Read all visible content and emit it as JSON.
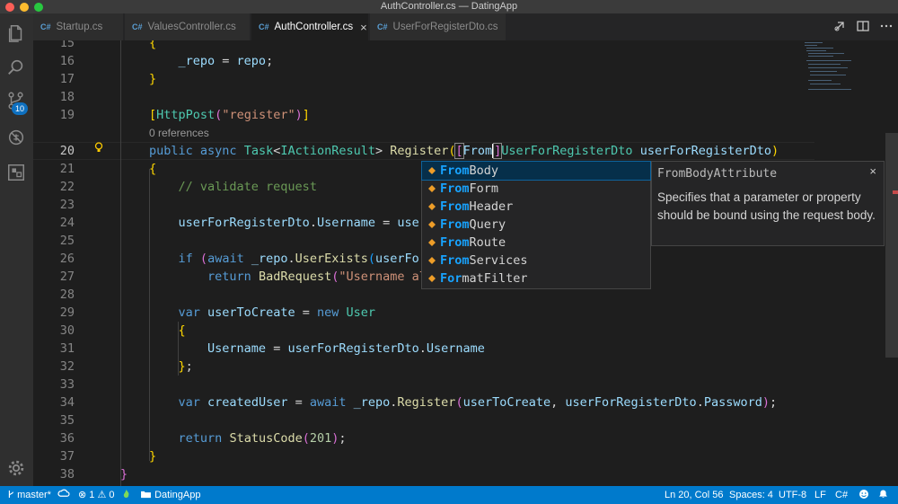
{
  "window": {
    "title": "AuthController.cs — DatingApp"
  },
  "activity_bar": {
    "icons": [
      "files-icon",
      "search-icon",
      "source-control-icon",
      "debug-icon",
      "extensions-icon",
      "settings-gear-icon"
    ],
    "scm_badge": "10"
  },
  "tabs": [
    {
      "label": "Startup.cs",
      "lang": "C#"
    },
    {
      "label": "ValuesController.cs",
      "lang": "C#"
    },
    {
      "label": "AuthController.cs",
      "lang": "C#",
      "active": true,
      "close": "×"
    },
    {
      "label": "UserForRegisterDto.cs",
      "lang": "C#"
    }
  ],
  "editor": {
    "code_lens": "0 references",
    "lines": [
      {
        "no": "15",
        "text": "{"
      },
      {
        "no": "16",
        "text": "    _repo = repo;"
      },
      {
        "no": "17",
        "text": "}"
      },
      {
        "no": "18",
        "text": ""
      },
      {
        "no": "19",
        "text": "[HttpPost(\"register\")]"
      },
      {
        "no": "20",
        "text": "public async Task<IActionResult> Register([From]UserForRegisterDto userForRegisterDto)"
      },
      {
        "no": "21",
        "text": "{"
      },
      {
        "no": "22",
        "text": "    // validate request"
      },
      {
        "no": "23",
        "text": ""
      },
      {
        "no": "24",
        "text": "    userForRegisterDto.Username = user"
      },
      {
        "no": "25",
        "text": ""
      },
      {
        "no": "26",
        "text": "    if (await _repo.UserExists(userFor"
      },
      {
        "no": "27",
        "text": "        return BadRequest(\"Username al"
      },
      {
        "no": "28",
        "text": ""
      },
      {
        "no": "29",
        "text": "    var userToCreate = new User"
      },
      {
        "no": "30",
        "text": "    {"
      },
      {
        "no": "31",
        "text": "        Username = userForRegisterDto.Username"
      },
      {
        "no": "32",
        "text": "    };"
      },
      {
        "no": "33",
        "text": ""
      },
      {
        "no": "34",
        "text": "    var createdUser = await _repo.Register(userToCreate, userForRegisterDto.Password);"
      },
      {
        "no": "35",
        "text": ""
      },
      {
        "no": "36",
        "text": "    return StatusCode(201);"
      },
      {
        "no": "37",
        "text": "}"
      },
      {
        "no": "38",
        "text": "}"
      }
    ],
    "cursor_line": "20"
  },
  "suggest": {
    "typed": "From",
    "items": [
      {
        "match": "From",
        "rest": "Body",
        "selected": true
      },
      {
        "match": "From",
        "rest": "Form"
      },
      {
        "match": "From",
        "rest": "Header"
      },
      {
        "match": "From",
        "rest": "Query"
      },
      {
        "match": "From",
        "rest": "Route"
      },
      {
        "match": "From",
        "rest": "Services"
      },
      {
        "match": "For",
        "rest": "matFilter",
        "mid": "m"
      }
    ],
    "details": {
      "title": "FromBodyAttribute",
      "close": "×",
      "description": "Specifies that a parameter or property should be bound using the request body."
    }
  },
  "status_bar": {
    "branch": "master*",
    "errors": "1",
    "warnings": "0",
    "project": "DatingApp",
    "position": "Ln 20, Col 56",
    "spaces": "Spaces: 4",
    "encoding": "UTF-8",
    "eol": "LF",
    "language": "C#"
  },
  "colors": {
    "statusbar": "#007acc",
    "editor_bg": "#1e1e1e",
    "accent": "#18a3ff"
  }
}
